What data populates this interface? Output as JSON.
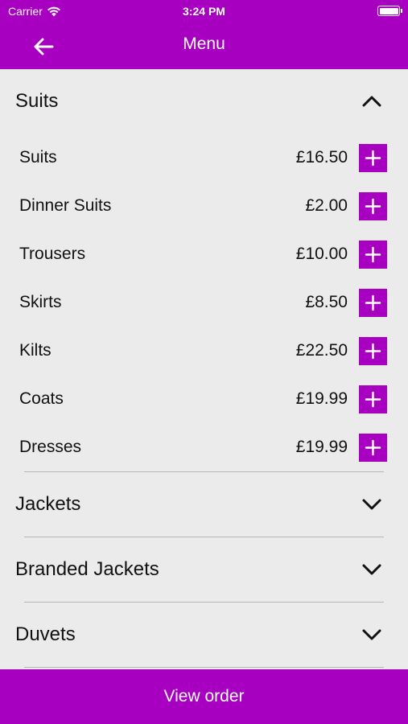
{
  "status": {
    "carrier": "Carrier",
    "time": "3:24 PM"
  },
  "nav": {
    "title": "Menu"
  },
  "sections": [
    {
      "title": "Suits",
      "expanded": true,
      "items": [
        {
          "name": "Suits",
          "price": "£16.50"
        },
        {
          "name": "Dinner Suits",
          "price": "£2.00"
        },
        {
          "name": "Trousers",
          "price": "£10.00"
        },
        {
          "name": "Skirts",
          "price": "£8.50"
        },
        {
          "name": "Kilts",
          "price": "£22.50"
        },
        {
          "name": "Coats",
          "price": "£19.99"
        },
        {
          "name": "Dresses",
          "price": "£19.99"
        }
      ]
    },
    {
      "title": "Jackets",
      "expanded": false
    },
    {
      "title": "Branded Jackets",
      "expanded": false
    },
    {
      "title": "Duvets",
      "expanded": false
    }
  ],
  "footer": {
    "label": "View order"
  },
  "colors": {
    "accent": "#a800c0",
    "background": "#ebebeb",
    "divider": "#b5b5b5"
  }
}
